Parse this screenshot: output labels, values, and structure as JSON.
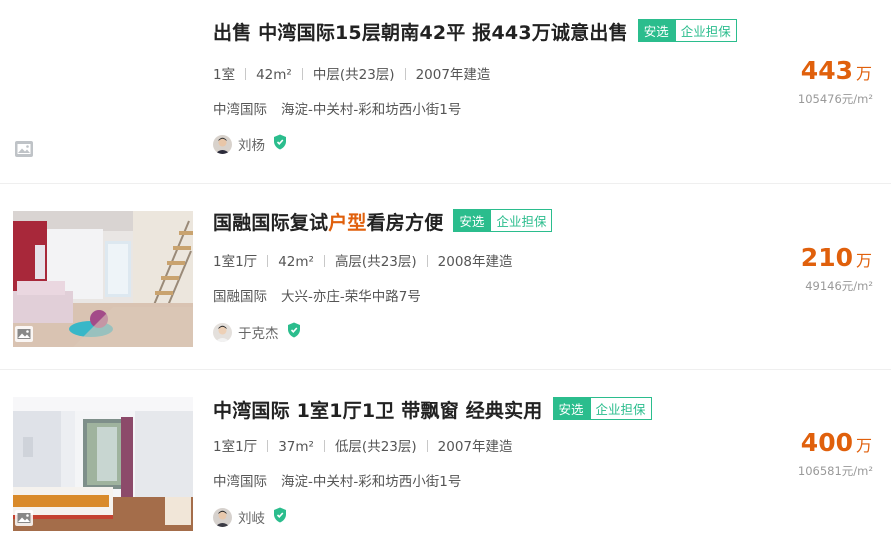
{
  "listings": [
    {
      "title": "出售 中湾国际15层朝南42平 报443万诚意出售",
      "title_parts": [
        "出售 中湾国际15层朝南42平 报443万诚意出售",
        "",
        ""
      ],
      "tag_primary": "安选",
      "tag_secondary": "企业担保",
      "layout": "1室",
      "area": "42m²",
      "floor": "中层(共23层)",
      "built": "2007年建造",
      "community": "中湾国际",
      "location": "海淀-中关村-彩和坊西小街1号",
      "agent": "刘杨",
      "price": "443",
      "price_unit": "万",
      "unit_price": "105476元/m²"
    },
    {
      "title": "国融国际复试户型看房方便",
      "title_parts": [
        "国融国际复试",
        "户型",
        "看房方便"
      ],
      "tag_primary": "安选",
      "tag_secondary": "企业担保",
      "layout": "1室1厅",
      "area": "42m²",
      "floor": "高层(共23层)",
      "built": "2008年建造",
      "community": "国融国际",
      "location": "大兴-亦庄-荣华中路7号",
      "agent": "于克杰",
      "price": "210",
      "price_unit": "万",
      "unit_price": "49146元/m²"
    },
    {
      "title": "中湾国际 1室1厅1卫 带飘窗 经典实用",
      "title_parts": [
        "中湾国际 1室1厅1卫 带飘窗 经典实用",
        "",
        ""
      ],
      "tag_primary": "安选",
      "tag_secondary": "企业担保",
      "layout": "1室1厅",
      "area": "37m²",
      "floor": "低层(共23层)",
      "built": "2007年建造",
      "community": "中湾国际",
      "location": "海淀-中关村-彩和坊西小街1号",
      "agent": "刘岐",
      "price": "400",
      "price_unit": "万",
      "unit_price": "106581元/m²"
    }
  ],
  "colors": {
    "accent_price": "#e0600c",
    "tag_green": "#2bbd8d",
    "shield_green": "#2bbd8d"
  },
  "icons": {
    "gallery": "image-gallery-icon",
    "verified": "verified-shield-icon"
  }
}
